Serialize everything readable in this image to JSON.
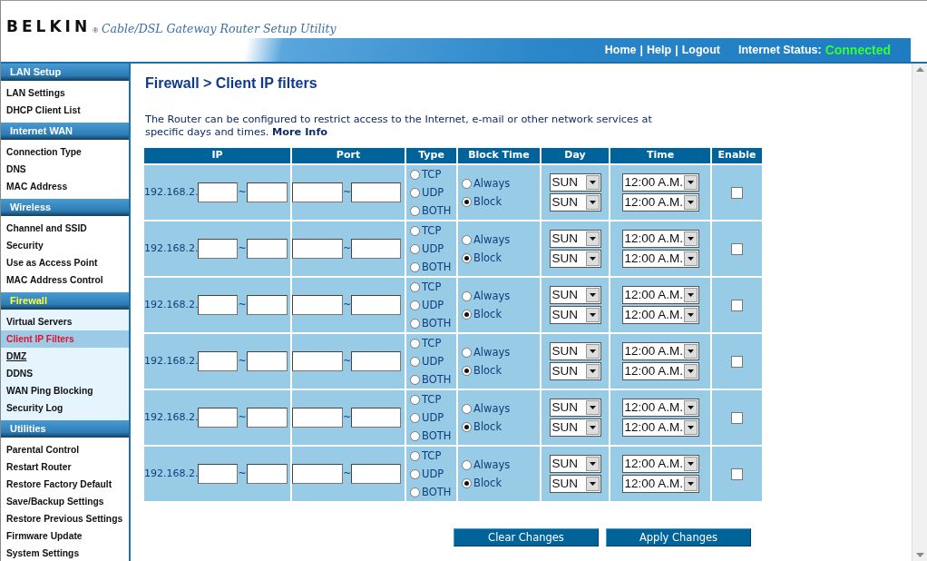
{
  "header": {
    "logo": "BELKIN",
    "logo_mark": "®",
    "tagline": "Cable/DSL Gateway Router Setup Utility",
    "links": [
      "Home",
      "Help",
      "Logout"
    ],
    "link_separator": "|",
    "status_label": "Internet Status:",
    "status_value": "Connected"
  },
  "sidebar": [
    {
      "title": "LAN Setup",
      "selected": false,
      "items": [
        {
          "label": "LAN Settings",
          "selected": false,
          "hover": false
        },
        {
          "label": "DHCP Client List",
          "selected": false,
          "hover": false
        }
      ]
    },
    {
      "title": "Internet WAN",
      "selected": false,
      "items": [
        {
          "label": "Connection Type",
          "selected": false,
          "hover": false
        },
        {
          "label": "DNS",
          "selected": false,
          "hover": false
        },
        {
          "label": "MAC Address",
          "selected": false,
          "hover": false
        }
      ]
    },
    {
      "title": "Wireless",
      "selected": false,
      "items": [
        {
          "label": "Channel and SSID",
          "selected": false,
          "hover": false
        },
        {
          "label": "Security",
          "selected": false,
          "hover": false
        },
        {
          "label": "Use as Access Point",
          "selected": false,
          "hover": false
        },
        {
          "label": "MAC Address Control",
          "selected": false,
          "hover": false
        }
      ]
    },
    {
      "title": "Firewall",
      "selected": true,
      "items": [
        {
          "label": "Virtual Servers",
          "selected": false,
          "hover": false
        },
        {
          "label": "Client IP Filters",
          "selected": true,
          "hover": false
        },
        {
          "label": "DMZ",
          "selected": false,
          "hover": true
        },
        {
          "label": "DDNS",
          "selected": false,
          "hover": false
        },
        {
          "label": "WAN Ping Blocking",
          "selected": false,
          "hover": false
        },
        {
          "label": "Security Log",
          "selected": false,
          "hover": false
        }
      ]
    },
    {
      "title": "Utilities",
      "selected": false,
      "items": [
        {
          "label": "Parental Control",
          "selected": false,
          "hover": false
        },
        {
          "label": "Restart Router",
          "selected": false,
          "hover": false
        },
        {
          "label": "Restore Factory Default",
          "selected": false,
          "hover": false
        },
        {
          "label": "Save/Backup Settings",
          "selected": false,
          "hover": false
        },
        {
          "label": "Restore Previous Settings",
          "selected": false,
          "hover": false
        },
        {
          "label": "Firmware Update",
          "selected": false,
          "hover": false
        },
        {
          "label": "System Settings",
          "selected": false,
          "hover": false
        }
      ]
    }
  ],
  "page": {
    "title": "Firewall > Client IP filters",
    "description": "The Router can be configured to restrict access to the Internet, e-mail or other network services at specific days and times.",
    "more_info": "More Info"
  },
  "table": {
    "columns": [
      "IP",
      "Port",
      "Type",
      "Block Time",
      "Day",
      "Time",
      "Enable"
    ],
    "rows": [
      {
        "ip_prefix": "192.168.2.",
        "ip_sep": "~",
        "port_sep": "~",
        "types": [
          {
            "label": "TCP",
            "selected": false
          },
          {
            "label": "UDP",
            "selected": false
          },
          {
            "label": "BOTH",
            "selected": false
          }
        ],
        "block": [
          {
            "label": "Always",
            "selected": false
          },
          {
            "label": "Block",
            "selected": true
          }
        ],
        "days": [
          "SUN",
          "SUN"
        ],
        "times": [
          "12:00 A.M.",
          "12:00 A.M."
        ],
        "enabled": false
      },
      {
        "ip_prefix": "192.168.2.",
        "ip_sep": "~",
        "port_sep": "~",
        "types": [
          {
            "label": "TCP",
            "selected": false
          },
          {
            "label": "UDP",
            "selected": false
          },
          {
            "label": "BOTH",
            "selected": false
          }
        ],
        "block": [
          {
            "label": "Always",
            "selected": false
          },
          {
            "label": "Block",
            "selected": true
          }
        ],
        "days": [
          "SUN",
          "SUN"
        ],
        "times": [
          "12:00 A.M.",
          "12:00 A.M."
        ],
        "enabled": false
      },
      {
        "ip_prefix": "192.168.2.",
        "ip_sep": "~",
        "port_sep": "~",
        "types": [
          {
            "label": "TCP",
            "selected": false
          },
          {
            "label": "UDP",
            "selected": false
          },
          {
            "label": "BOTH",
            "selected": false
          }
        ],
        "block": [
          {
            "label": "Always",
            "selected": false
          },
          {
            "label": "Block",
            "selected": true
          }
        ],
        "days": [
          "SUN",
          "SUN"
        ],
        "times": [
          "12:00 A.M.",
          "12:00 A.M."
        ],
        "enabled": false
      },
      {
        "ip_prefix": "192.168.2.",
        "ip_sep": "~",
        "port_sep": "~",
        "types": [
          {
            "label": "TCP",
            "selected": false
          },
          {
            "label": "UDP",
            "selected": false
          },
          {
            "label": "BOTH",
            "selected": false
          }
        ],
        "block": [
          {
            "label": "Always",
            "selected": false
          },
          {
            "label": "Block",
            "selected": true
          }
        ],
        "days": [
          "SUN",
          "SUN"
        ],
        "times": [
          "12:00 A.M.",
          "12:00 A.M."
        ],
        "enabled": false
      },
      {
        "ip_prefix": "192.168.2.",
        "ip_sep": "~",
        "port_sep": "~",
        "types": [
          {
            "label": "TCP",
            "selected": false
          },
          {
            "label": "UDP",
            "selected": false
          },
          {
            "label": "BOTH",
            "selected": false
          }
        ],
        "block": [
          {
            "label": "Always",
            "selected": false
          },
          {
            "label": "Block",
            "selected": true
          }
        ],
        "days": [
          "SUN",
          "SUN"
        ],
        "times": [
          "12:00 A.M.",
          "12:00 A.M."
        ],
        "enabled": false
      },
      {
        "ip_prefix": "192.168.2.",
        "ip_sep": "~",
        "port_sep": "~",
        "types": [
          {
            "label": "TCP",
            "selected": false
          },
          {
            "label": "UDP",
            "selected": false
          },
          {
            "label": "BOTH",
            "selected": false
          }
        ],
        "block": [
          {
            "label": "Always",
            "selected": false
          },
          {
            "label": "Block",
            "selected": true
          }
        ],
        "days": [
          "SUN",
          "SUN"
        ],
        "times": [
          "12:00 A.M.",
          "12:00 A.M."
        ],
        "enabled": false
      }
    ]
  },
  "buttons": [
    "Clear Changes",
    "Apply Changes"
  ]
}
